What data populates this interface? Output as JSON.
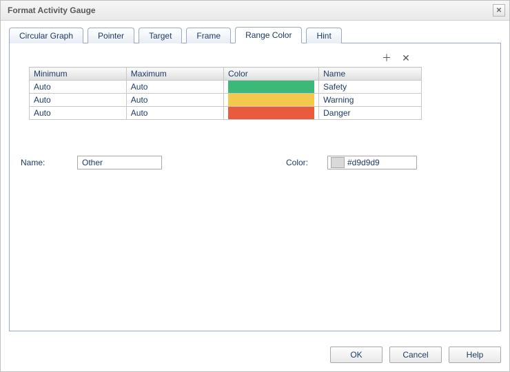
{
  "title": "Format Activity Gauge",
  "titlebar_close_icon": "✕",
  "tabs": [
    {
      "label": "Circular Graph"
    },
    {
      "label": "Pointer"
    },
    {
      "label": "Target"
    },
    {
      "label": "Frame"
    },
    {
      "label": "Range Color",
      "active": true
    },
    {
      "label": "Hint"
    }
  ],
  "rangeTable": {
    "headers": {
      "min": "Minimum",
      "max": "Maximum",
      "color": "Color",
      "name": "Name"
    },
    "rows": [
      {
        "min": "Auto",
        "max": "Auto",
        "color": "#3cb878",
        "name": "Safety"
      },
      {
        "min": "Auto",
        "max": "Auto",
        "color": "#f2c94c",
        "name": "Warning"
      },
      {
        "min": "Auto",
        "max": "Auto",
        "color": "#eb5a3c",
        "name": "Danger"
      }
    ]
  },
  "actions": {
    "add_icon": "＋",
    "remove_icon": "✕"
  },
  "form": {
    "name_label": "Name:",
    "name_value": "Other",
    "color_label": "Color:",
    "color_value": "#d9d9d9",
    "color_swatch": "#d9d9d9"
  },
  "buttons": {
    "ok": "OK",
    "cancel": "Cancel",
    "help": "Help"
  }
}
